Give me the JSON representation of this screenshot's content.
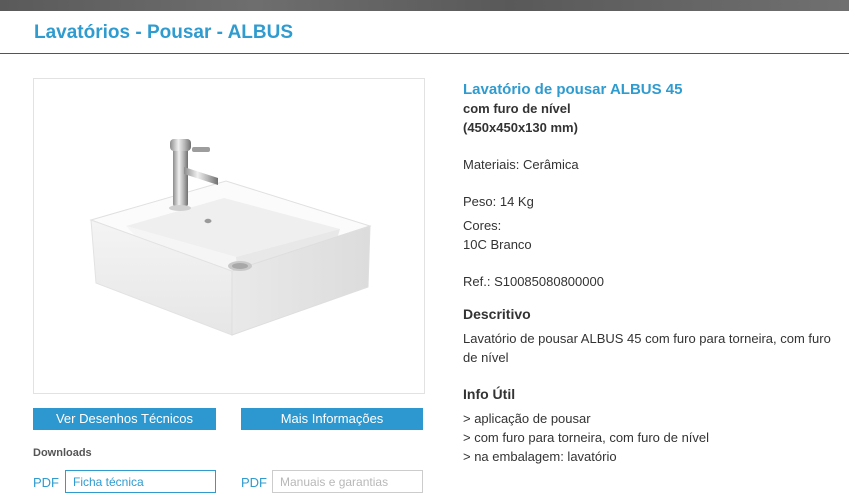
{
  "page": {
    "title": "Lavatórios - Pousar - ALBUS"
  },
  "product": {
    "image_alt": "Lavatório de pousar ALBUS 45",
    "name": "Lavatório de pousar ALBUS 45",
    "subtitle_1": "com furo de nível",
    "subtitle_2": "(450x450x130 mm)",
    "materials": "Materiais: Cerâmica",
    "weight": "Peso: 14 Kg",
    "colors_label": "Cores:",
    "colors_value": "10C Branco",
    "reference": "Ref.: S10085080800000"
  },
  "description": {
    "heading": "Descritivo",
    "text": "Lavatório de pousar ALBUS 45 com furo para torneira, com furo de nível"
  },
  "info_util": {
    "heading": "Info Útil",
    "items": [
      "> aplicação de pousar",
      "> com furo para torneira, com furo de nível",
      "> na embalagem: lavatório"
    ]
  },
  "buttons": {
    "drawings": "Ver Desenhos Técnicos",
    "more_info": "Mais Informações"
  },
  "downloads": {
    "label": "Downloads",
    "items": [
      {
        "type": "PDF",
        "name": "Ficha técnica"
      },
      {
        "type": "PDF",
        "name": "Manuais e garantias"
      }
    ]
  },
  "colors": {
    "accent": "#2f9bcf",
    "button": "#2d97cf",
    "text": "#333333"
  }
}
